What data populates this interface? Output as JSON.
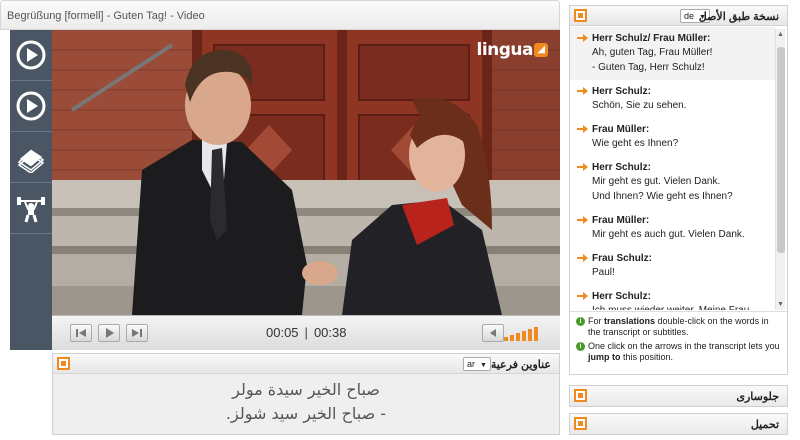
{
  "video": {
    "title": "Begrüßung [formell] - Guten Tag! - Video",
    "logo_text": "lingua",
    "time_current": "00:05",
    "time_separator": "|",
    "time_total": "00:38"
  },
  "side_toolbar": {
    "items": [
      {
        "icon": "play-circle-icon"
      },
      {
        "icon": "play-circle-icon"
      },
      {
        "icon": "flashcards-icon"
      },
      {
        "icon": "weightlifter-icon"
      }
    ]
  },
  "subtitles": {
    "title": "عناوين فرعية",
    "language": "ar",
    "lines": [
      "صباح الخير سيدة مولر",
      "- صباح الخير سيد شولز."
    ]
  },
  "transcript": {
    "title": "نسخة طبق الأصل",
    "language": "de",
    "entries": [
      {
        "speaker": "Herr Schulz/ Frau Müller:",
        "lines": [
          "Ah, guten Tag, Frau Müller!",
          "- Guten Tag, Herr Schulz!"
        ],
        "active": true
      },
      {
        "speaker": "Herr Schulz:",
        "lines": [
          "Schön, Sie zu sehen."
        ]
      },
      {
        "speaker": "Frau Müller:",
        "lines": [
          "Wie geht es Ihnen?"
        ]
      },
      {
        "speaker": "Herr Schulz:",
        "lines": [
          "Mir geht es gut. Vielen Dank.",
          "Und Ihnen? Wie geht es Ihnen?"
        ]
      },
      {
        "speaker": "Frau Müller:",
        "lines": [
          "Mir geht es auch gut. Vielen Dank."
        ]
      },
      {
        "speaker": "Frau Schulz:",
        "lines": [
          "Paul!"
        ]
      },
      {
        "speaker": "Herr Schulz:",
        "lines": [
          "Ich muss wieder weiter. Meine Frau"
        ]
      }
    ],
    "help": [
      {
        "pre": "For ",
        "bold": "translations",
        "post": " double-click on the words in the transcript or subtitles."
      },
      {
        "pre": "One click on the arrows in the transcript lets you ",
        "bold": "jump to",
        "post": " this position."
      }
    ]
  },
  "sections": {
    "glossary": "جلوسارى",
    "download": "تحميل"
  },
  "colors": {
    "accent": "#f08a20",
    "toolbar": "#4a5663",
    "help_icon": "#4a9a2a"
  }
}
